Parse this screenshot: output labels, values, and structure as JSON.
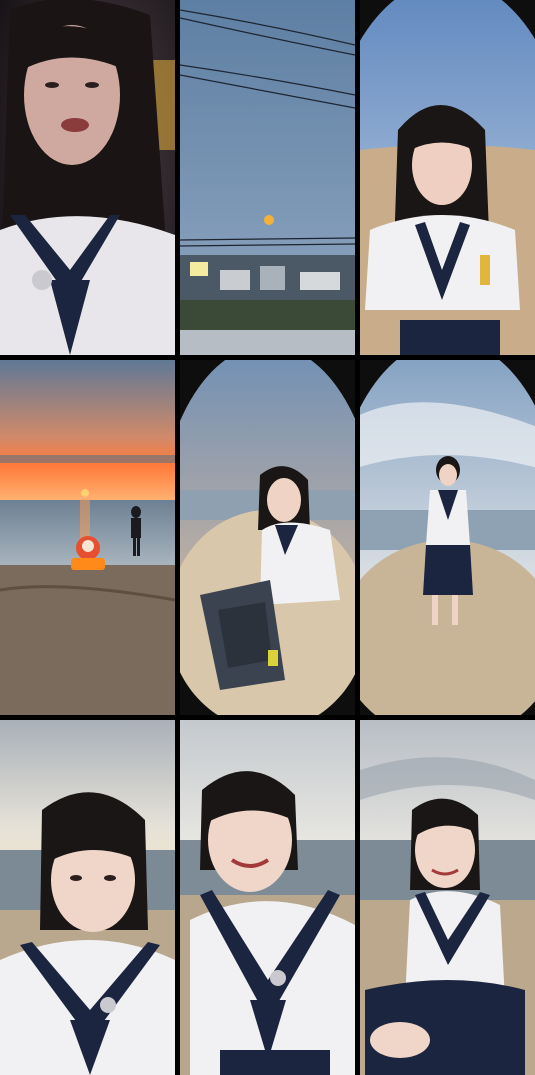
{
  "grid": {
    "rows": 3,
    "columns": 3,
    "background": "#000000",
    "tiles": [
      {
        "id": "tile-1",
        "subject": "selfie-dark-evening",
        "sky": "#3a3038"
      },
      {
        "id": "tile-2",
        "subject": "moon-over-town",
        "sky": "#6f8fb0"
      },
      {
        "id": "tile-3",
        "subject": "girl-on-beach-fisheye",
        "sky": "#8fb0d6"
      },
      {
        "id": "tile-4",
        "subject": "sunset-beach-silhouette",
        "sky": "#ff8a4a"
      },
      {
        "id": "tile-5",
        "subject": "girl-with-backpack-sunset",
        "sky": "#7fa0c8"
      },
      {
        "id": "tile-6",
        "subject": "girl-standing-clouds",
        "sky": "#a8bfd8"
      },
      {
        "id": "tile-7",
        "subject": "closeup-sunrise-left",
        "sky": "#c9ced2"
      },
      {
        "id": "tile-8",
        "subject": "closeup-smiling-center",
        "sky": "#d2d6d8"
      },
      {
        "id": "tile-9",
        "subject": "closeup-sitting-right",
        "sky": "#cdd2d6"
      }
    ]
  }
}
